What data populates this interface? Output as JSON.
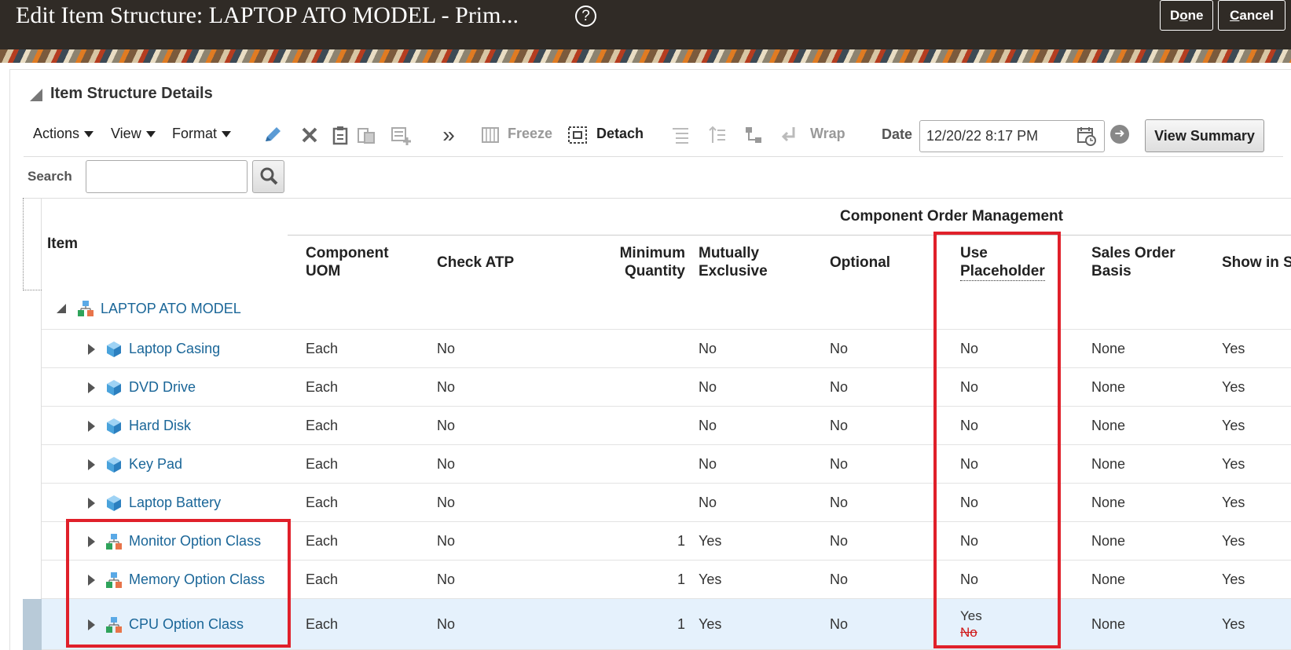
{
  "header": {
    "title": "Edit Item Structure: LAPTOP ATO MODEL - Prim...",
    "help_icon": "help-circle-icon",
    "done_label": "Done",
    "cancel_label": "Cancel"
  },
  "section": {
    "title": "Item Structure Details"
  },
  "toolbar": {
    "actions": "Actions",
    "view": "View",
    "format": "Format",
    "freeze": "Freeze",
    "detach": "Detach",
    "wrap": "Wrap",
    "date_label": "Date",
    "date_value": "12/20/22 8:17 PM",
    "view_summary": "View Summary",
    "icons": [
      "pencil-icon",
      "delete-x-icon",
      "clipboard-icon",
      "paste-icon",
      "add-row-icon",
      "more-chevrons-icon",
      "freeze-icon",
      "detach-icon",
      "collapse-icon",
      "expand-icon",
      "hierarchy-icon",
      "wrap-icon",
      "calendar-icon",
      "go-arrow-icon"
    ]
  },
  "search": {
    "label": "Search",
    "value": "",
    "icon": "magnifier-icon"
  },
  "table": {
    "group_header": "Component Order Management",
    "columns": {
      "item": "Item",
      "uom_1": "Component",
      "uom_2": "UOM",
      "check_atp": "Check ATP",
      "min_qty_1": "Minimum",
      "min_qty_2": "Quantity",
      "mutex_1": "Mutually",
      "mutex_2": "Exclusive",
      "optional": "Optional",
      "placeholder_1": "Use",
      "placeholder_2": "Placeholder",
      "sales_1": "Sales Order",
      "sales_2": "Basis",
      "show": "Show in S"
    },
    "root": "LAPTOP ATO MODEL",
    "rows": [
      {
        "item": "Laptop Casing",
        "icon": "item-cube-icon",
        "uom": "Each",
        "atp": "No",
        "min": "",
        "mutex": "No",
        "optional": "No",
        "placeholder": "No",
        "basis": "None",
        "show": "Yes"
      },
      {
        "item": "DVD Drive",
        "icon": "item-cube-icon",
        "uom": "Each",
        "atp": "No",
        "min": "",
        "mutex": "No",
        "optional": "No",
        "placeholder": "No",
        "basis": "None",
        "show": "Yes"
      },
      {
        "item": "Hard Disk",
        "icon": "item-cube-icon",
        "uom": "Each",
        "atp": "No",
        "min": "",
        "mutex": "No",
        "optional": "No",
        "placeholder": "No",
        "basis": "None",
        "show": "Yes"
      },
      {
        "item": "Key Pad",
        "icon": "item-cube-icon",
        "uom": "Each",
        "atp": "No",
        "min": "",
        "mutex": "No",
        "optional": "No",
        "placeholder": "No",
        "basis": "None",
        "show": "Yes"
      },
      {
        "item": "Laptop Battery",
        "icon": "item-cube-icon",
        "uom": "Each",
        "atp": "No",
        "min": "",
        "mutex": "No",
        "optional": "No",
        "placeholder": "No",
        "basis": "None",
        "show": "Yes"
      },
      {
        "item": "Monitor Option Class",
        "icon": "option-class-icon",
        "uom": "Each",
        "atp": "No",
        "min": "1",
        "mutex": "Yes",
        "optional": "No",
        "placeholder": "No",
        "basis": "None",
        "show": "Yes"
      },
      {
        "item": "Memory Option Class",
        "icon": "option-class-icon",
        "uom": "Each",
        "atp": "No",
        "min": "1",
        "mutex": "Yes",
        "optional": "No",
        "placeholder": "No",
        "basis": "None",
        "show": "Yes"
      },
      {
        "item": "CPU Option Class",
        "icon": "option-class-icon",
        "uom": "Each",
        "atp": "No",
        "min": "1",
        "mutex": "Yes",
        "optional": "No",
        "placeholder": "Yes",
        "placeholder_old": "No",
        "basis": "None",
        "show": "Yes"
      }
    ]
  },
  "colors": {
    "header_bg": "#302b26",
    "link": "#1a6698",
    "highlight": "#e0202a",
    "selected_row": "#e5f1fc"
  }
}
